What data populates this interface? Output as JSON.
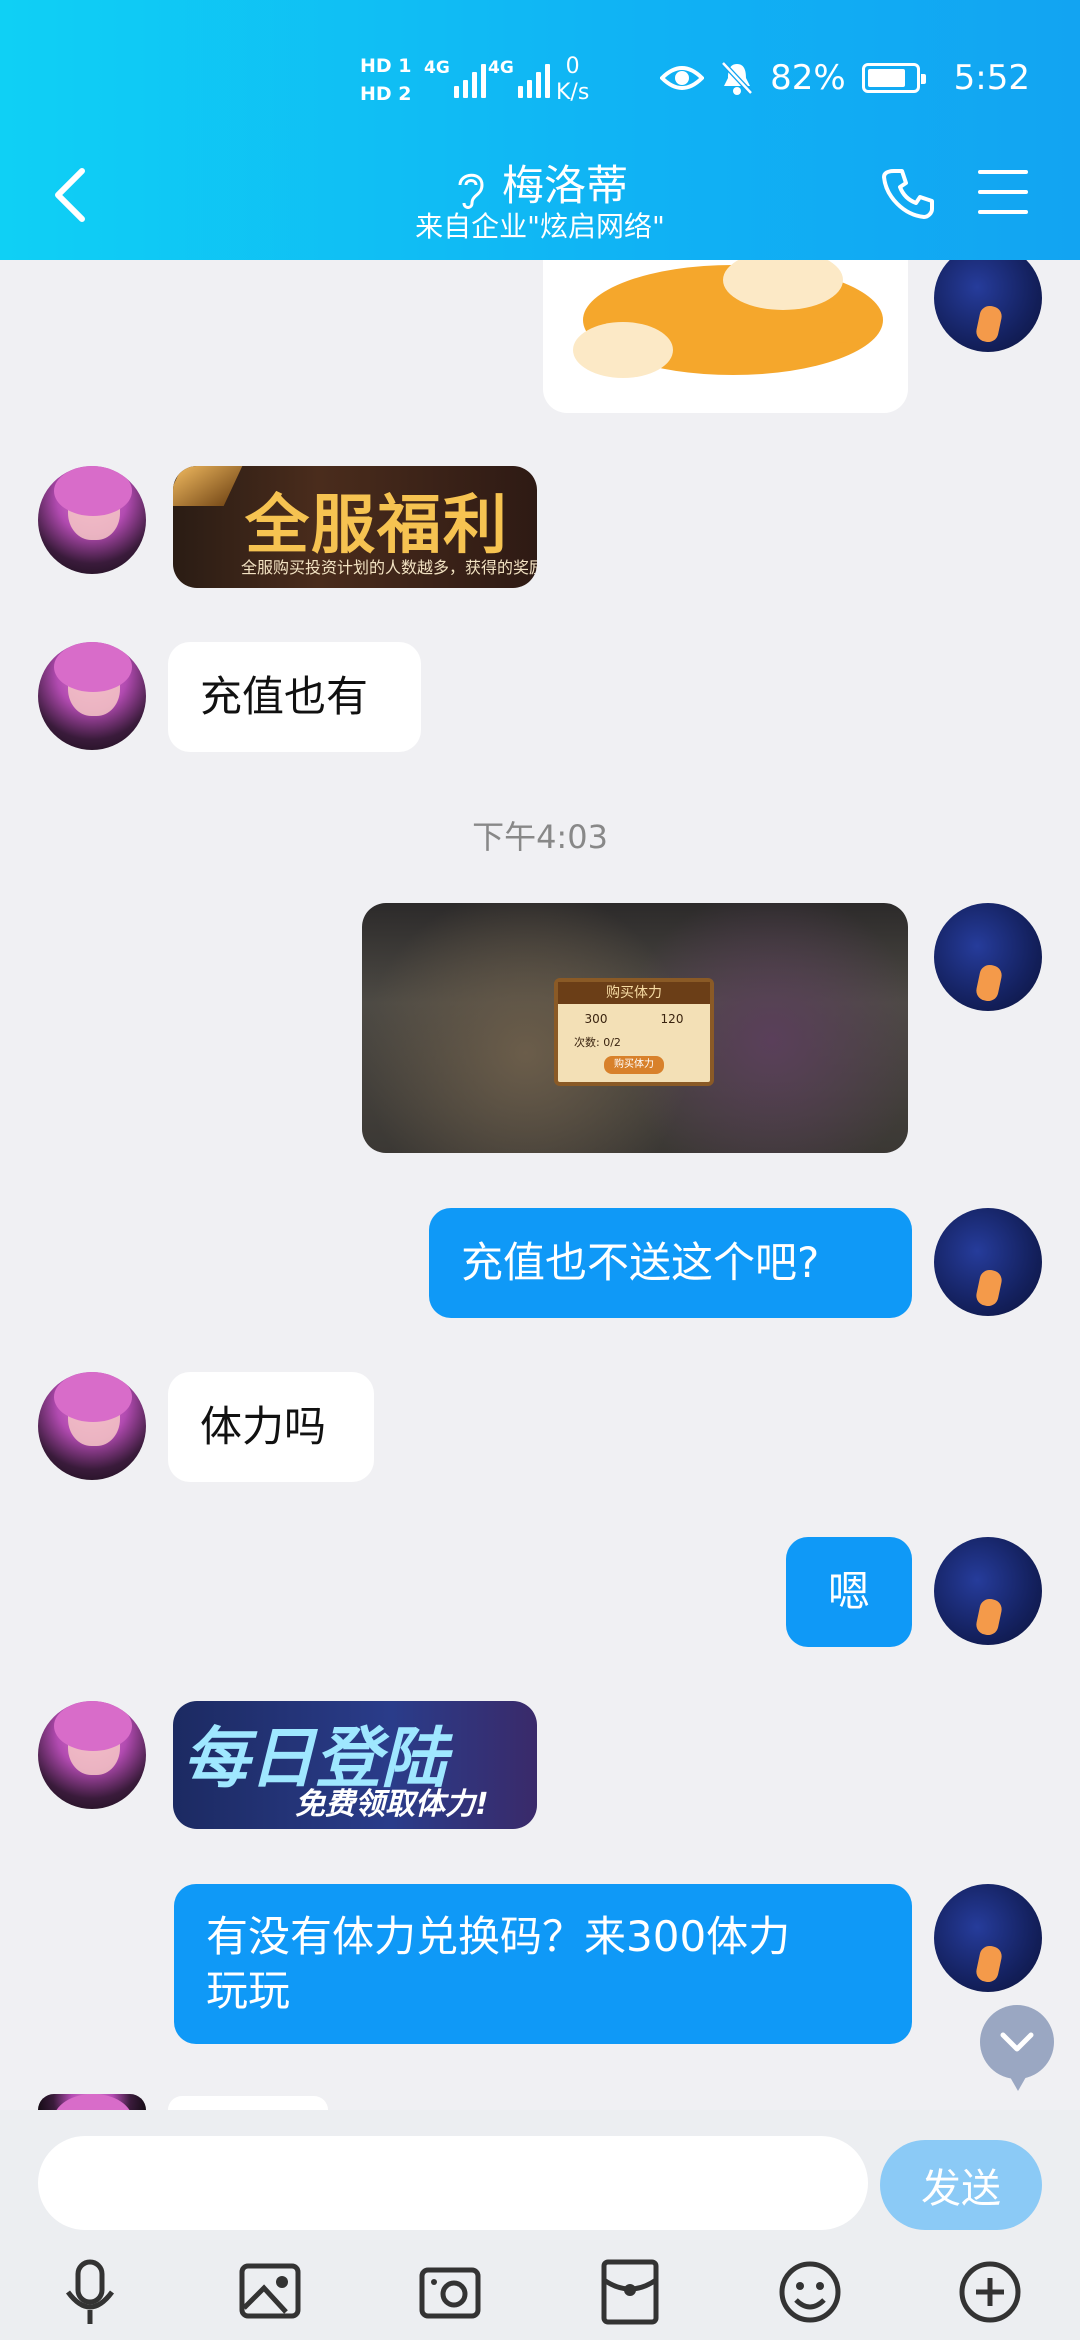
{
  "status_bar": {
    "hd1": "HD 1",
    "hd2": "HD 2",
    "sig1": "4G",
    "sig2": "4G",
    "net_speed_value": "0",
    "net_speed_unit": "K/s",
    "battery": "82%",
    "time": "5:52"
  },
  "header": {
    "title": "梅洛蒂",
    "subtitle": "来自企业\"炫启网络\""
  },
  "timestamp": "下午4:03",
  "messages": {
    "left_banner1_text": "全服福利",
    "left_banner1_sub": "全服购买投资计划的人数越多，获得的奖励",
    "left_text1": "充值也有",
    "right_img_title": "购买体力",
    "right_img_value_a": "300",
    "right_img_value_b": "120",
    "right_img_count": "次数: 0/2",
    "right_img_button": "购买体力",
    "right_text1": "充值也不送这个吧?",
    "left_text2": "体力吗",
    "right_text2": "嗯",
    "left_banner2_main": "每日登陆",
    "left_banner2_sub": "免费领取体力!",
    "right_text3_line1": "有没有体力兑换码？来300体力",
    "right_text3_line2": "玩玩"
  },
  "input": {
    "placeholder": "",
    "send_label": "发送"
  },
  "toolbar": {
    "icons": [
      "microphone-icon",
      "image-icon",
      "camera-icon",
      "red-packet-icon",
      "emoji-icon",
      "plus-icon"
    ]
  },
  "colors": {
    "header_start": "#0fd0f5",
    "header_end": "#12a4f2",
    "bubble_blue": "#0f99f7",
    "send_button": "#8bcaf6"
  }
}
